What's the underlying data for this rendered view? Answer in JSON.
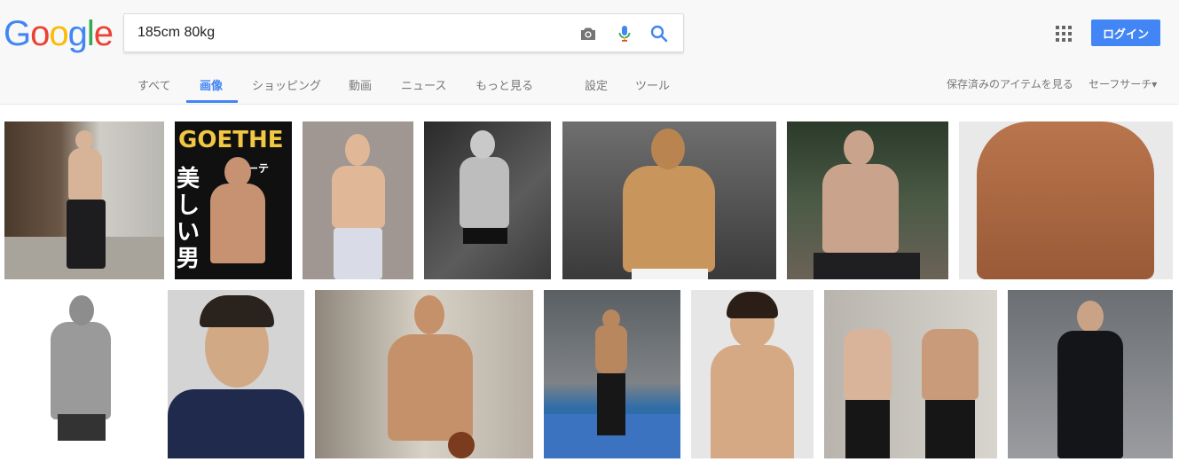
{
  "logo": {
    "letters": [
      "G",
      "o",
      "o",
      "g",
      "l",
      "e"
    ],
    "colors": [
      "#4285f4",
      "#ea4335",
      "#fbbc05",
      "#4285f4",
      "#34a853",
      "#ea4335"
    ]
  },
  "search": {
    "query": "185cm 80kg",
    "placeholder": ""
  },
  "header": {
    "login_label": "ログイン"
  },
  "tabs": [
    {
      "label": "すべて"
    },
    {
      "label": "画像"
    },
    {
      "label": "ショッピング"
    },
    {
      "label": "動画"
    },
    {
      "label": "ニュース"
    },
    {
      "label": "もっと見る"
    },
    {
      "label": "設定"
    },
    {
      "label": "ツール"
    }
  ],
  "right_links": {
    "saved": "保存済みのアイテムを見る",
    "safesearch": "セーフサーチ▾"
  },
  "magazine": {
    "title": "GOETHE",
    "subtitle": "ゲーテ",
    "headline": "美しい男"
  },
  "colors": {
    "accent": "#4285f4",
    "tab_text": "#777777",
    "header_bg": "#f8f8f8"
  }
}
